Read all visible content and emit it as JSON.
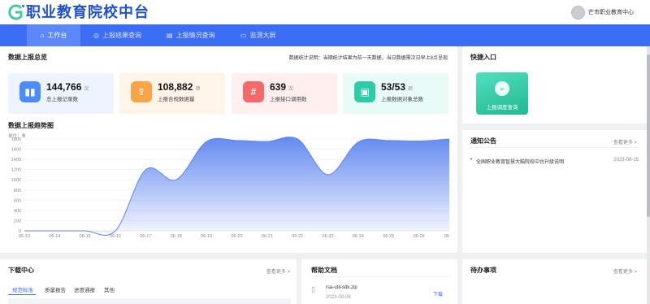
{
  "header": {
    "title": "职业教育院校中台",
    "user_name": "芒市职业教育中心"
  },
  "nav": {
    "items": [
      {
        "label": "工作台",
        "icon": "home-icon"
      },
      {
        "label": "上报结果查询",
        "icon": "check-circle-icon"
      },
      {
        "label": "上报情况查询",
        "icon": "document-icon"
      },
      {
        "label": "监测大屏",
        "icon": "monitor-icon"
      }
    ]
  },
  "overview": {
    "title": "数据上报总览",
    "note": "数据统计说明：当期统计结果为前一天数据，当日数据需次日早上8点呈现",
    "stats": [
      {
        "value": "144,766",
        "unit": "次",
        "label": "总上报记录数",
        "icon": "bar-chart-icon",
        "color": "#4b8df8",
        "bg": "#eef4ff"
      },
      {
        "value": "108,882",
        "unit": "项",
        "label": "上报合规数据量",
        "icon": "upload-icon",
        "color": "#f7a547",
        "bg": "#fff4e8"
      },
      {
        "value": "639",
        "unit": "次",
        "label": "上报接口调用数",
        "icon": "hash-icon",
        "color": "#f46a6a",
        "bg": "#ffefef"
      },
      {
        "value": "53/53",
        "unit": "项",
        "label": "上报数据对象总数",
        "icon": "archive-icon",
        "color": "#2ccca6",
        "bg": "#e9fbf7"
      }
    ]
  },
  "trend": {
    "title": "数据上报趋势图",
    "unit_label": "单位：条"
  },
  "chart_data": {
    "type": "area",
    "title": "数据上报趋势图",
    "ylabel": "单位：条",
    "x": [
      "06-13",
      "06-14",
      "06-15",
      "06-16",
      "06-17",
      "06-18",
      "06-19",
      "06-20",
      "06-21",
      "06-22",
      "06-23",
      "06-24",
      "06-25",
      "06-26",
      "06-27"
    ],
    "x_tick_labels": [
      "06-13",
      "06-14",
      "06-15",
      "06-16",
      "06-17",
      "06-18",
      "06-19",
      "06-20",
      "06-21",
      "06-22",
      "06-23",
      "06-24",
      "06-25",
      "06-26",
      "06"
    ],
    "series": [
      {
        "values": [
          0,
          0,
          0,
          0,
          1200,
          1000,
          1750,
          1770,
          1750,
          1800,
          1100,
          1740,
          1770,
          1760,
          1800
        ]
      }
    ],
    "y_ticks": [
      0,
      200,
      400,
      600,
      800,
      1000,
      1200,
      1400,
      1600,
      1800
    ],
    "ylim": [
      0,
      1800
    ],
    "grid": true,
    "colors": {
      "line": "#5b84f0",
      "fill": "#5b84f0"
    }
  },
  "quick": {
    "title": "快捷入口",
    "tile_label": "上报调度查询",
    "tile_icon": "search-icon"
  },
  "notice": {
    "title": "通知公告",
    "more": "查看更多 >",
    "items": [
      {
        "text": "全国职业教育智慧大脑院校中台升级说明",
        "date": "2023-08-15"
      }
    ]
  },
  "download": {
    "title": "下载中心",
    "more": "查看更多 >",
    "tabs": [
      "规范标准",
      "质量报告",
      "进度通报",
      "其他"
    ]
  },
  "help": {
    "title": "帮助文档",
    "file": {
      "name": "rsa-util-sdk.zip",
      "date": "2023-09-06",
      "action": "下载",
      "icon": "file-icon"
    }
  },
  "todo": {
    "title": "待办事项",
    "more": "查看更多 >"
  }
}
